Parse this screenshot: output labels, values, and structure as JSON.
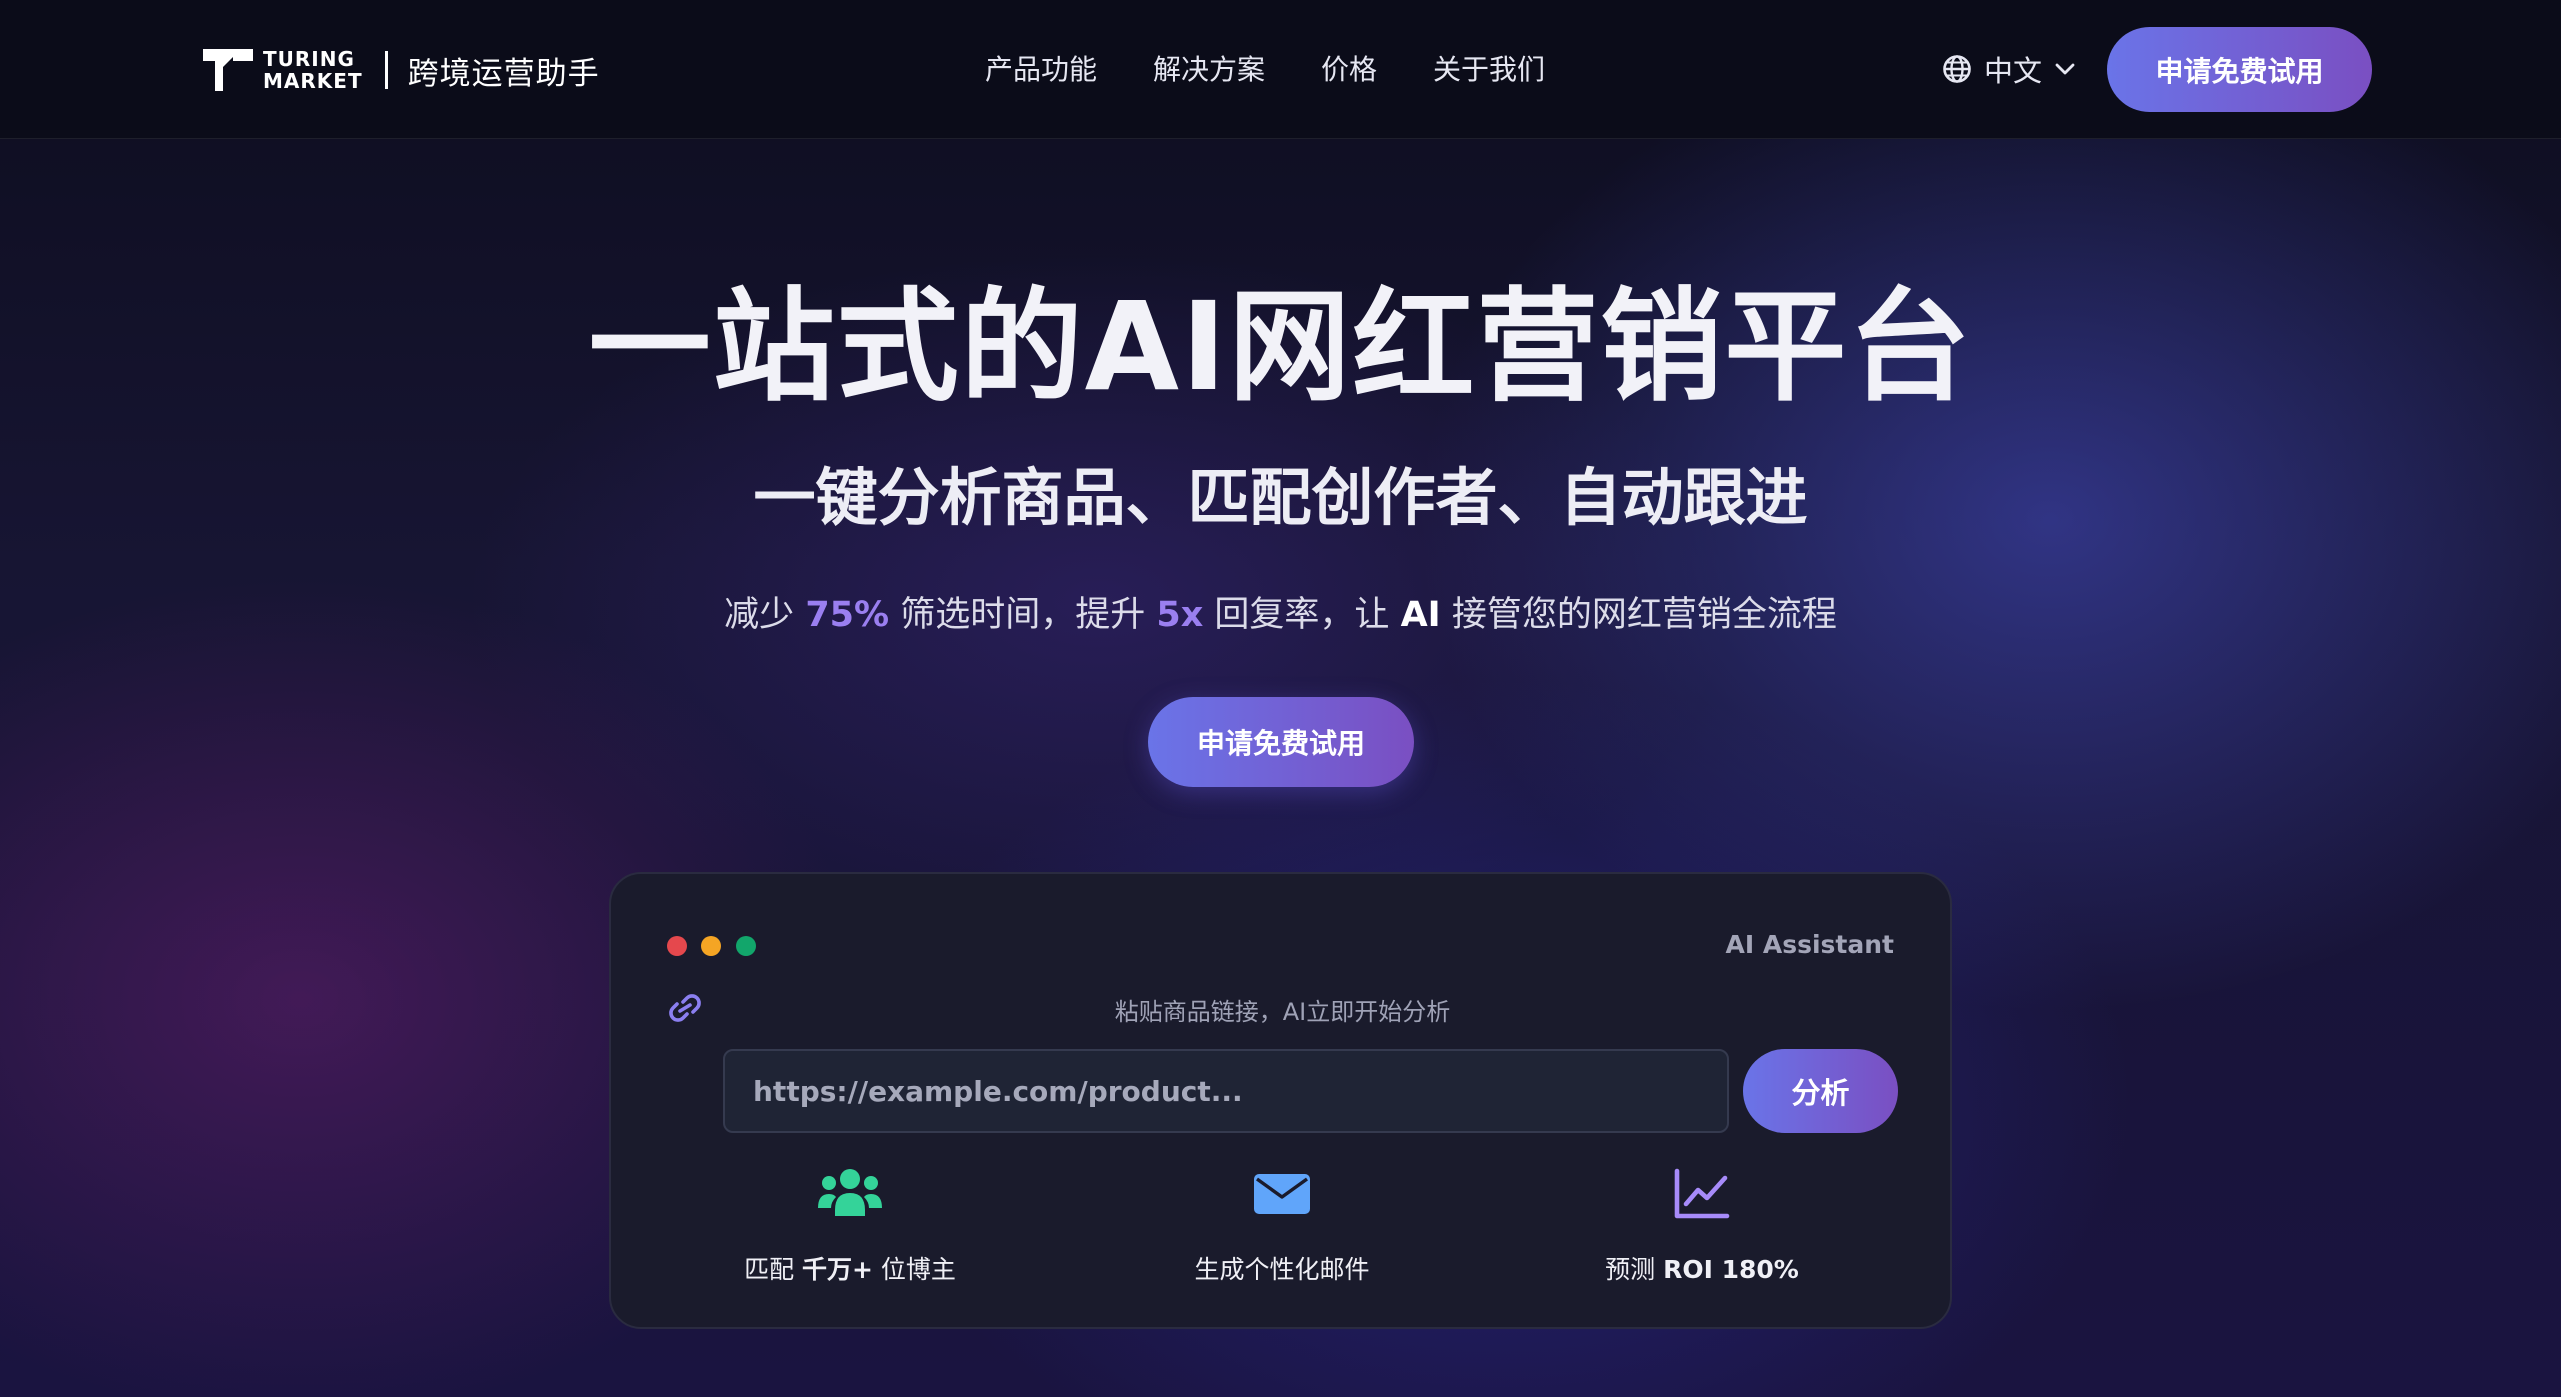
{
  "brand": {
    "logo_line1": "TURING",
    "logo_line2": "MARKET",
    "product_name": "跨境运营助手"
  },
  "nav": {
    "items": [
      {
        "label": "产品功能"
      },
      {
        "label": "解决方案"
      },
      {
        "label": "价格"
      },
      {
        "label": "关于我们"
      }
    ]
  },
  "header": {
    "language": "中文",
    "cta_label": "申请免费试用"
  },
  "hero": {
    "title": "一站式的AI网红营销平台",
    "subtitle": "一键分析商品、匹配创作者、自动跟进",
    "desc": {
      "part1": "减少 ",
      "stat1": "75%",
      "part2": " 筛选时间，提升 ",
      "stat2": "5x",
      "part3": " 回复率，让 ",
      "ai": "AI",
      "part4": " 接管您的网红营销全流程"
    },
    "cta_label": "申请免费试用"
  },
  "demo_card": {
    "title": "AI Assistant",
    "hint": "粘贴商品链接，AI立即开始分析",
    "input_placeholder": "https://example.com/product...",
    "analyze_label": "分析",
    "features": [
      {
        "icon": "users-icon",
        "prefix": "匹配 ",
        "strong": "千万+",
        "suffix": " 位博主"
      },
      {
        "icon": "envelope-icon",
        "prefix": "生成个性化邮件",
        "strong": "",
        "suffix": ""
      },
      {
        "icon": "chart-line-icon",
        "prefix": "预测 ",
        "strong": "ROI 180%",
        "suffix": ""
      }
    ]
  },
  "colors": {
    "accent_start": "#6a74e8",
    "accent_end": "#7a4fc2",
    "highlight": "#9a7ff0",
    "dot_red": "#e5484d",
    "dot_yellow": "#f5a524",
    "dot_green": "#12a66b",
    "users_icon": "#34d399",
    "envelope_icon": "#60a5fa",
    "chart_icon": "#a78bfa"
  }
}
